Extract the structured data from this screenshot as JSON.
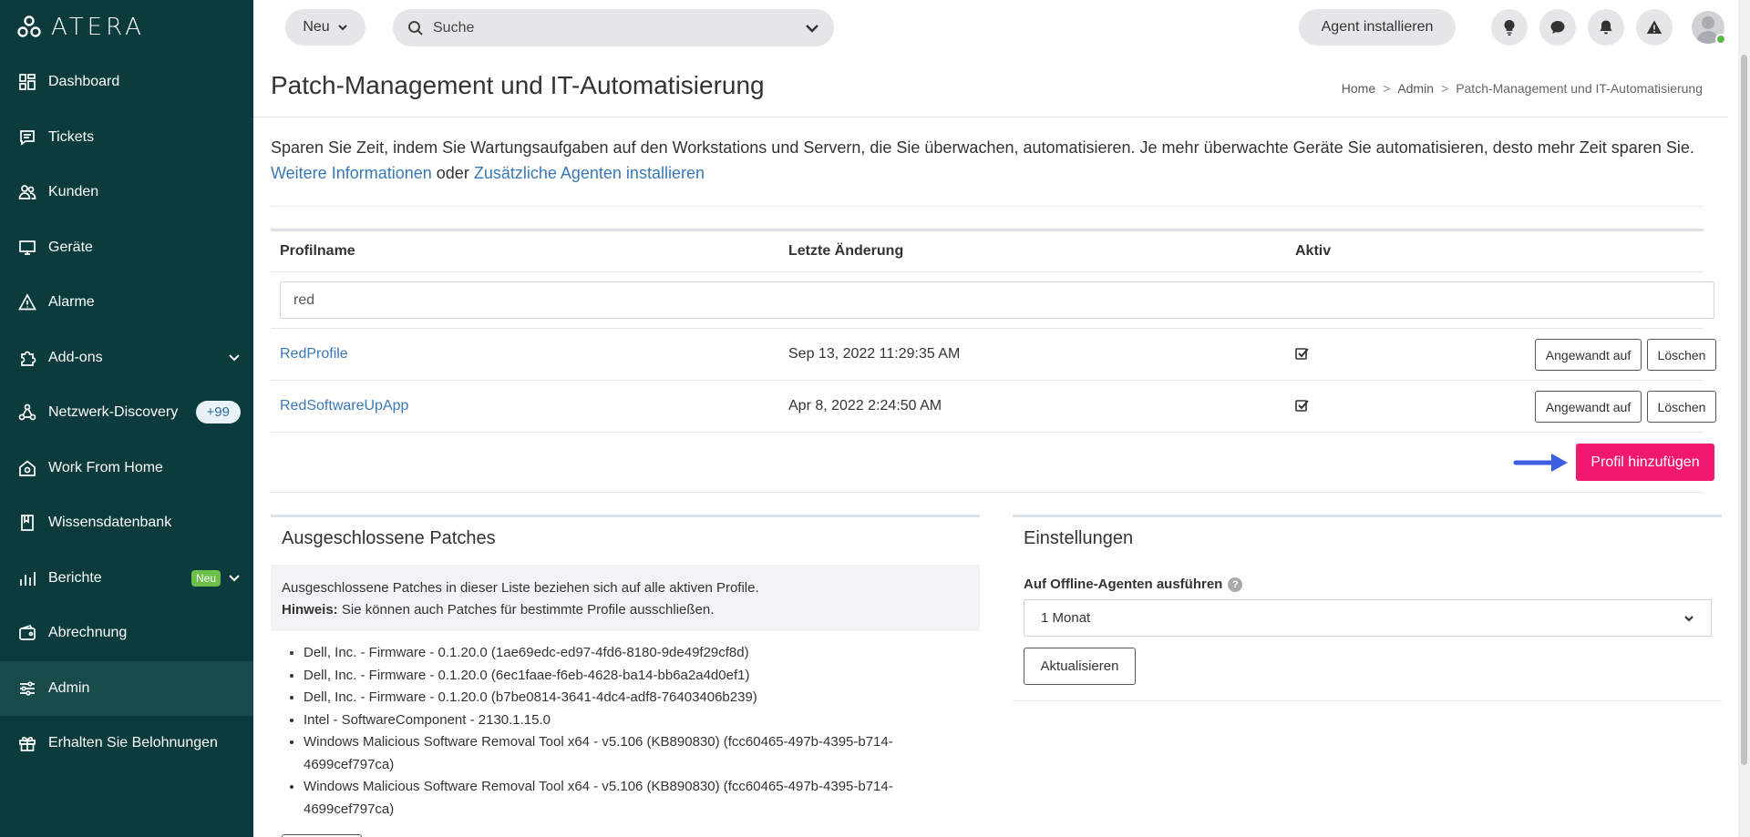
{
  "brand": {
    "name": "ATERA"
  },
  "sidebar": {
    "items": [
      {
        "label": "Dashboard",
        "icon": "dashboard-icon"
      },
      {
        "label": "Tickets",
        "icon": "tickets-icon"
      },
      {
        "label": "Kunden",
        "icon": "customers-icon"
      },
      {
        "label": "Geräte",
        "icon": "devices-icon"
      },
      {
        "label": "Alarme",
        "icon": "alerts-icon"
      },
      {
        "label": "Add-ons",
        "icon": "addons-icon"
      },
      {
        "label": "Netzwerk-Discovery",
        "icon": "network-icon",
        "badge": "+99"
      },
      {
        "label": "Work From Home",
        "icon": "home-icon"
      },
      {
        "label": "Wissensdatenbank",
        "icon": "book-icon"
      },
      {
        "label": "Berichte",
        "icon": "reports-icon",
        "new_badge": "Neu"
      },
      {
        "label": "Abrechnung",
        "icon": "billing-icon"
      },
      {
        "label": "Admin",
        "icon": "admin-icon",
        "active": true
      },
      {
        "label": "Erhalten Sie Belohnungen",
        "icon": "gift-icon"
      }
    ]
  },
  "topbar": {
    "new_label": "Neu",
    "search_placeholder": "Suche",
    "agent_label": "Agent installieren"
  },
  "page": {
    "title": "Patch-Management und IT-Automatisierung",
    "breadcrumb": [
      "Home",
      "Admin",
      "Patch-Management und IT-Automatisierung"
    ],
    "intro": "Sparen Sie Zeit, indem Sie Wartungsaufgaben auf den Workstations und Servern, die Sie überwachen, automatisieren. Je mehr überwachte Geräte Sie automatisieren, desto mehr Zeit sparen Sie.",
    "link_more": "Weitere Informationen",
    "link_or": "oder",
    "link_agents": "Zusätzliche Agenten installieren"
  },
  "table": {
    "headers": [
      "Profilname",
      "Letzte Änderung",
      "Aktiv"
    ],
    "filter_value": "red",
    "rows": [
      {
        "name": "RedProfile",
        "date": "Sep 13, 2022 11:29:35 AM",
        "active": true
      },
      {
        "name": "RedSoftwareUpApp",
        "date": "Apr 8, 2022 2:24:50 AM",
        "active": true
      }
    ],
    "applied_label": "Angewandt auf",
    "delete_label": "Löschen",
    "add_label": "Profil hinzufügen"
  },
  "excluded": {
    "title": "Ausgeschlossene Patches",
    "note_line1": "Ausgeschlossene Patches in dieser Liste beziehen sich auf alle aktiven Profile.",
    "note_hint_label": "Hinweis:",
    "note_hint_text": " Sie können auch Patches für bestimmte Profile ausschließen.",
    "patches": [
      "Dell, Inc. - Firmware - 0.1.20.0 (1ae69edc-ed97-4fd6-8180-9de49f29cf8d)",
      "Dell, Inc. - Firmware - 0.1.20.0 (6ec1faae-f6eb-4628-ba14-bb6a2a4d0ef1)",
      "Dell, Inc. - Firmware - 0.1.20.0 (b7be0814-3641-4dc4-adf8-76403406b239)",
      "Intel - SoftwareComponent - 2130.1.15.0",
      "Windows Malicious Software Removal Tool x64 - v5.106 (KB890830) (fcc60465-497b-4395-b714-4699cef797ca)",
      "Windows Malicious Software Removal Tool x64 - v5.106 (KB890830) (fcc60465-497b-4395-b714-4699cef797ca)"
    ]
  },
  "settings": {
    "title": "Einstellungen",
    "offline_label": "Auf Offline-Agenten ausführen",
    "offline_value": "1 Monat",
    "update_label": "Aktualisieren"
  },
  "colors": {
    "sidebar": "#0b3b3c",
    "accent": "#f0196f",
    "link": "#3a78b5"
  }
}
